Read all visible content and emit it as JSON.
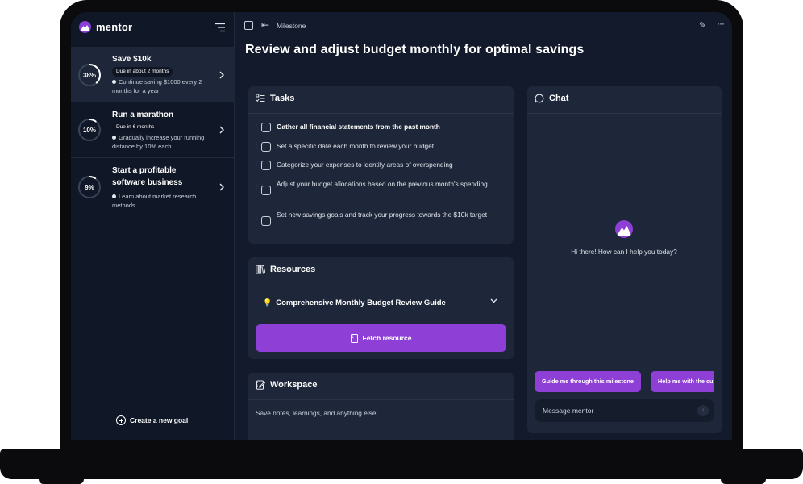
{
  "brand": {
    "name": "mentor"
  },
  "sidebar": {
    "goals": [
      {
        "title": "Save $10k",
        "progress_label": "38%",
        "progress": 0.38,
        "due": "Due in about 2 months",
        "step": "Continue saving $1000 every 2 months for a year",
        "active": true
      },
      {
        "title": "Run a marathon",
        "progress_label": "10%",
        "progress": 0.1,
        "due": "Due in 6 months",
        "step": "Gradually increase your running distance by 10% each...",
        "active": false
      },
      {
        "title": "Start a profitable software business",
        "progress_label": "9%",
        "progress": 0.09,
        "due": "",
        "step": "Learn about market research methods",
        "active": false
      }
    ],
    "create_goal_label": "Create a new goal"
  },
  "topbar": {
    "breadcrumb": "Milestone"
  },
  "page": {
    "title": "Review and adjust budget monthly for optimal savings"
  },
  "tasks": {
    "heading": "Tasks",
    "items": [
      {
        "text": "Gather all financial statements from the past month",
        "bold": true
      },
      {
        "text": "Set a specific date each month to review your budget",
        "bold": false
      },
      {
        "text": "Categorize your expenses to identify areas of overspending",
        "bold": false
      },
      {
        "text": "Adjust your budget allocations based on the previous month's spending",
        "bold": false
      },
      {
        "text": "Set new savings goals and track your progress towards the $10k target",
        "bold": false
      }
    ]
  },
  "resources": {
    "heading": "Resources",
    "item": "Comprehensive Monthly Budget Review Guide",
    "fetch_label": "Fetch resource"
  },
  "workspace": {
    "heading": "Workspace",
    "placeholder": "Save notes, learnings, and anything else..."
  },
  "chat": {
    "heading": "Chat",
    "greeting": "Hi there! How can I help you today?",
    "suggestions": [
      "Guide me through this milestone",
      "Help me with the cu"
    ],
    "input_placeholder": "Message mentor"
  },
  "colors": {
    "accent": "#8e3fd6",
    "background": "#131a2b",
    "sidebar": "#101727",
    "card": "#1e2739"
  },
  "icons": [
    "menu-icon",
    "chevron-right-icon",
    "plus-circle-icon",
    "sidebar-collapse-icon",
    "arrow-left-icon",
    "pencil-icon",
    "more-icon",
    "list-check-icon",
    "books-icon",
    "lightbulb-icon",
    "chevron-down-icon",
    "file-download-icon",
    "notebook-pen-icon",
    "chat-bubble-icon",
    "arrow-up-icon"
  ]
}
